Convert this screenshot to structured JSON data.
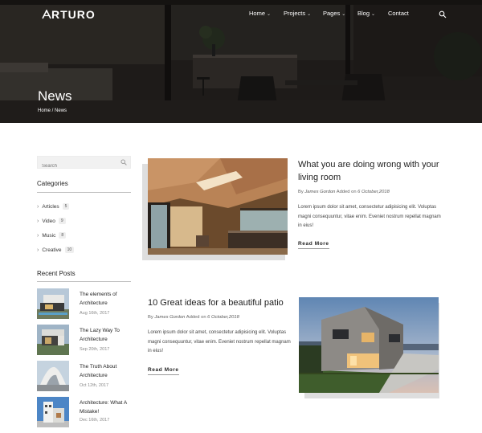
{
  "brand": {
    "logo_text": "RTURO"
  },
  "nav": {
    "items": [
      {
        "label": "Home",
        "has_dropdown": true
      },
      {
        "label": "Projects",
        "has_dropdown": true
      },
      {
        "label": "Pages",
        "has_dropdown": true
      },
      {
        "label": "Blog",
        "has_dropdown": true
      },
      {
        "label": "Contact",
        "has_dropdown": false
      }
    ],
    "caret": "⌄",
    "search_icon": "search-icon"
  },
  "hero": {
    "title": "News",
    "breadcrumb": {
      "home": "Home",
      "separator": " / ",
      "current": "News"
    }
  },
  "sidebar": {
    "search": {
      "placeholder": "Search"
    },
    "categories": {
      "heading": "Categories",
      "items": [
        {
          "label": "Articles",
          "count": "5"
        },
        {
          "label": "Video",
          "count": "9"
        },
        {
          "label": "Music",
          "count": "8"
        },
        {
          "label": "Creative",
          "count": "10"
        }
      ]
    },
    "recent_posts": {
      "heading": "Recent Posts",
      "items": [
        {
          "title": "The elements of Architecture",
          "date": "Aug 16th, 2017"
        },
        {
          "title": "The Lazy Way To Architecture",
          "date": "Sep 20th, 2017"
        },
        {
          "title": "The Truth About Architecture",
          "date": "Oct 12th, 2017"
        },
        {
          "title": "Architecture: What A Mistake!",
          "date": "Dec 16th, 2017"
        }
      ]
    }
  },
  "posts": [
    {
      "title": "What you are doing wrong with your living room",
      "meta_by": "By",
      "author": "James Gordon",
      "meta_added": "Added on",
      "date": "6 October,2018",
      "excerpt": "Lorem ipsum dolor sit amet, consectetur adipisicing elit. Voluptas magni consequuntur, vitae enim. Eveniet nostrum repellat magnam in eius!",
      "read_more": "Read More"
    },
    {
      "title": "10 Great ideas for a beautiful patio",
      "meta_by": "By",
      "author": "James Gordon",
      "meta_added": "Added on",
      "date": "6 October,2018",
      "excerpt": "Lorem ipsum dolor sit amet, consectetur adipisicing elit. Voluptas magni consequuntur, vitae enim. Eveniet nostrum repellat magnam in eius!",
      "read_more": "Read More"
    }
  ]
}
